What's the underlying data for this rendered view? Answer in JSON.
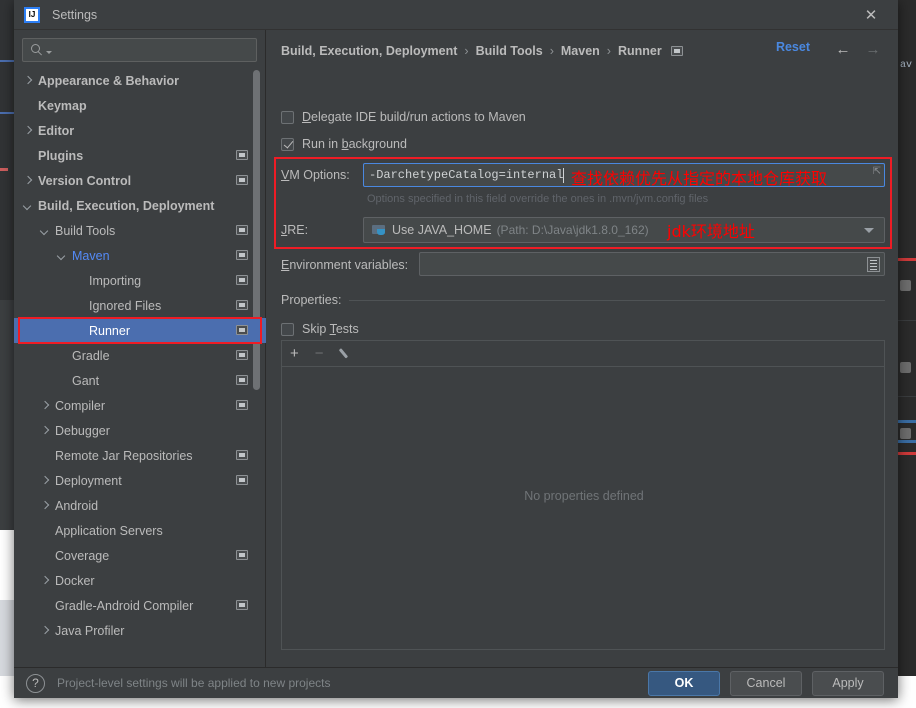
{
  "window": {
    "title": "Settings",
    "logo_text": "IJ",
    "close_icon": "✕"
  },
  "search": {
    "value": "",
    "placeholder": ""
  },
  "sidebar": {
    "items": [
      {
        "label": "Appearance & Behavior",
        "indent": 0,
        "arrow": "right",
        "bold": true,
        "cfg": false,
        "selected": false,
        "accent": false
      },
      {
        "label": "Keymap",
        "indent": 0,
        "arrow": "none",
        "bold": true,
        "cfg": false,
        "selected": false,
        "accent": false
      },
      {
        "label": "Editor",
        "indent": 0,
        "arrow": "right",
        "bold": true,
        "cfg": false,
        "selected": false,
        "accent": false
      },
      {
        "label": "Plugins",
        "indent": 0,
        "arrow": "none",
        "bold": true,
        "cfg": true,
        "selected": false,
        "accent": false
      },
      {
        "label": "Version Control",
        "indent": 0,
        "arrow": "right",
        "bold": true,
        "cfg": true,
        "selected": false,
        "accent": false
      },
      {
        "label": "Build, Execution, Deployment",
        "indent": 0,
        "arrow": "down",
        "bold": true,
        "cfg": false,
        "selected": false,
        "accent": false
      },
      {
        "label": "Build Tools",
        "indent": 1,
        "arrow": "down",
        "bold": false,
        "cfg": true,
        "selected": false,
        "accent": false
      },
      {
        "label": "Maven",
        "indent": 2,
        "arrow": "down",
        "bold": false,
        "cfg": true,
        "selected": false,
        "accent": true
      },
      {
        "label": "Importing",
        "indent": 3,
        "arrow": "none",
        "bold": false,
        "cfg": true,
        "selected": false,
        "accent": false
      },
      {
        "label": "Ignored Files",
        "indent": 3,
        "arrow": "none",
        "bold": false,
        "cfg": true,
        "selected": false,
        "accent": false
      },
      {
        "label": "Runner",
        "indent": 3,
        "arrow": "none",
        "bold": false,
        "cfg": true,
        "selected": true,
        "accent": false
      },
      {
        "label": "Gradle",
        "indent": 2,
        "arrow": "none",
        "bold": false,
        "cfg": true,
        "selected": false,
        "accent": false
      },
      {
        "label": "Gant",
        "indent": 2,
        "arrow": "none",
        "bold": false,
        "cfg": true,
        "selected": false,
        "accent": false
      },
      {
        "label": "Compiler",
        "indent": 1,
        "arrow": "right",
        "bold": false,
        "cfg": true,
        "selected": false,
        "accent": false
      },
      {
        "label": "Debugger",
        "indent": 1,
        "arrow": "right",
        "bold": false,
        "cfg": false,
        "selected": false,
        "accent": false
      },
      {
        "label": "Remote Jar Repositories",
        "indent": 1,
        "arrow": "none",
        "bold": false,
        "cfg": true,
        "selected": false,
        "accent": false
      },
      {
        "label": "Deployment",
        "indent": 1,
        "arrow": "right",
        "bold": false,
        "cfg": true,
        "selected": false,
        "accent": false
      },
      {
        "label": "Android",
        "indent": 1,
        "arrow": "right",
        "bold": false,
        "cfg": false,
        "selected": false,
        "accent": false
      },
      {
        "label": "Application Servers",
        "indent": 1,
        "arrow": "none",
        "bold": false,
        "cfg": false,
        "selected": false,
        "accent": false
      },
      {
        "label": "Coverage",
        "indent": 1,
        "arrow": "none",
        "bold": false,
        "cfg": true,
        "selected": false,
        "accent": false
      },
      {
        "label": "Docker",
        "indent": 1,
        "arrow": "right",
        "bold": false,
        "cfg": false,
        "selected": false,
        "accent": false
      },
      {
        "label": "Gradle-Android Compiler",
        "indent": 1,
        "arrow": "none",
        "bold": false,
        "cfg": true,
        "selected": false,
        "accent": false
      },
      {
        "label": "Java Profiler",
        "indent": 1,
        "arrow": "right",
        "bold": false,
        "cfg": false,
        "selected": false,
        "accent": false
      }
    ]
  },
  "main": {
    "breadcrumb": [
      "Build, Execution, Deployment",
      "Build Tools",
      "Maven",
      "Runner"
    ],
    "breadcrumb_sep": "›",
    "reset_label": "Reset",
    "back_icon": "←",
    "forward_icon": "→",
    "checkboxes": [
      {
        "label_pre": "D",
        "label_post": "elegate IDE build/run actions to Maven",
        "checked": false
      },
      {
        "label_pre": "",
        "label_post": "Run in background",
        "checked": true
      }
    ],
    "run_in_background_parts": {
      "a": "Run in ",
      "b": "b",
      "c": "ackground"
    },
    "vm_options": {
      "label_pre": "V",
      "label_post": "M Options:",
      "value": "-DarchetypeCatalog=internal",
      "expand_glyph": "⇱",
      "hint": "Options specified in this field override the ones in .mvn/jvm.config files"
    },
    "jre": {
      "label_pre": "J",
      "label_post": "RE:",
      "selected": "Use JAVA_HOME",
      "path": "(Path: D:\\Java\\jdk1.8.0_162)"
    },
    "env": {
      "label_pre": "E",
      "label_post": "nvironment variables:",
      "value": ""
    },
    "properties": {
      "title": "Properties:",
      "skip_tests_pre": "Skip ",
      "skip_tests_mid": "T",
      "skip_tests_post": "ests",
      "skip_tests_checked": false,
      "toolbar": {
        "add": "+",
        "remove": "−",
        "edit": "edit-pencil"
      },
      "empty_text": "No properties defined"
    }
  },
  "annotations": [
    {
      "text": "查找依赖优先从指定的本地仓库获取",
      "color": "#ff0000"
    },
    {
      "text": "jdk环境地址",
      "color": "#ff0000"
    }
  ],
  "footer": {
    "help_icon": "?",
    "message": "Project-level settings will be applied to new projects",
    "buttons": [
      {
        "label": "OK",
        "primary": true
      },
      {
        "label": "Cancel",
        "primary": false
      },
      {
        "label": "Apply",
        "primary": false
      }
    ]
  },
  "background": {
    "right_code_fragment": "av"
  }
}
